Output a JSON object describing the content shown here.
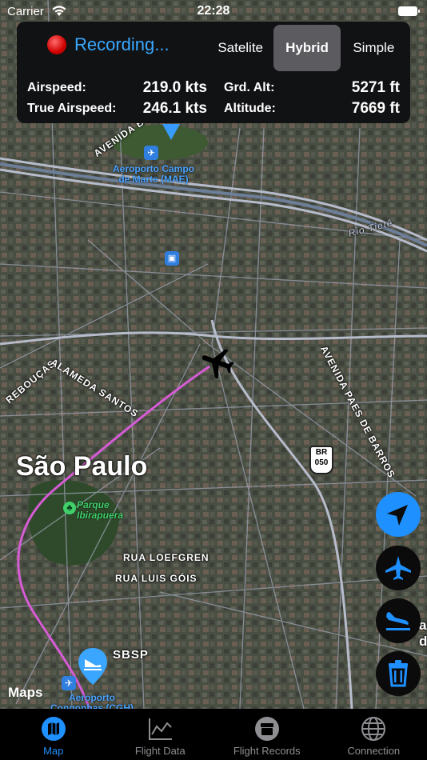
{
  "status": {
    "carrier": "Carrier",
    "time": "22:28"
  },
  "recording": {
    "label": "Recording..."
  },
  "map_types": [
    {
      "label": "Satelite",
      "active": false
    },
    {
      "label": "Hybrid",
      "active": true
    },
    {
      "label": "Simple",
      "active": false
    }
  ],
  "readouts": {
    "airspeed": {
      "label": "Airspeed:",
      "value": "219.0 kts"
    },
    "true_airspeed": {
      "label": "True Airspeed:",
      "value": "246.1 kts"
    },
    "grd_alt": {
      "label": "Grd. Alt:",
      "value": "5271 ft"
    },
    "altitude": {
      "label": "Altitude:",
      "value": "7669 ft"
    }
  },
  "map": {
    "city": "São Paulo",
    "airport_mae": "Aeroporto Campo\nde Marte (MAE)",
    "airport_mae_l1": "Aeroporto Campo",
    "airport_mae_l2": "de Marte (MAE)",
    "park_l1": "Parque",
    "park_l2": "Ibirapuera",
    "river": "Rio Tietê",
    "streets": {
      "avenida_b": "AVENIDA B",
      "alameda": "ALAMEDA SANTOS",
      "reboucas": "REBOUÇAS",
      "paes": "AVENIDA PAES DE BARROS",
      "loefgren": "RUA LOEFGREN",
      "luis": "RUA LUIS GÓIS"
    },
    "br_shield": {
      "top": "BR",
      "bottom": "050"
    },
    "airport_cgh_l1": "Aeroporto",
    "airport_cgh_l2": "Congonhas (CGH)",
    "destination": "SBSP",
    "maps_logo": "Maps",
    "partial_labels": {
      "a": "a",
      "d": "d"
    }
  },
  "buttons": {
    "center": "location-arrow-icon",
    "takeoff": "takeoff-icon",
    "landing": "landing-icon",
    "delete": "trash-icon"
  },
  "tabs": [
    {
      "label": "Map",
      "icon": "map-icon",
      "active": true
    },
    {
      "label": "Flight Data",
      "icon": "chart-icon",
      "active": false
    },
    {
      "label": "Flight Records",
      "icon": "records-icon",
      "active": false
    },
    {
      "label": "Connection",
      "icon": "globe-icon",
      "active": false
    }
  ],
  "colors": {
    "accent": "#1e90ff",
    "route": "#d65cd6",
    "record": "#e00000"
  }
}
